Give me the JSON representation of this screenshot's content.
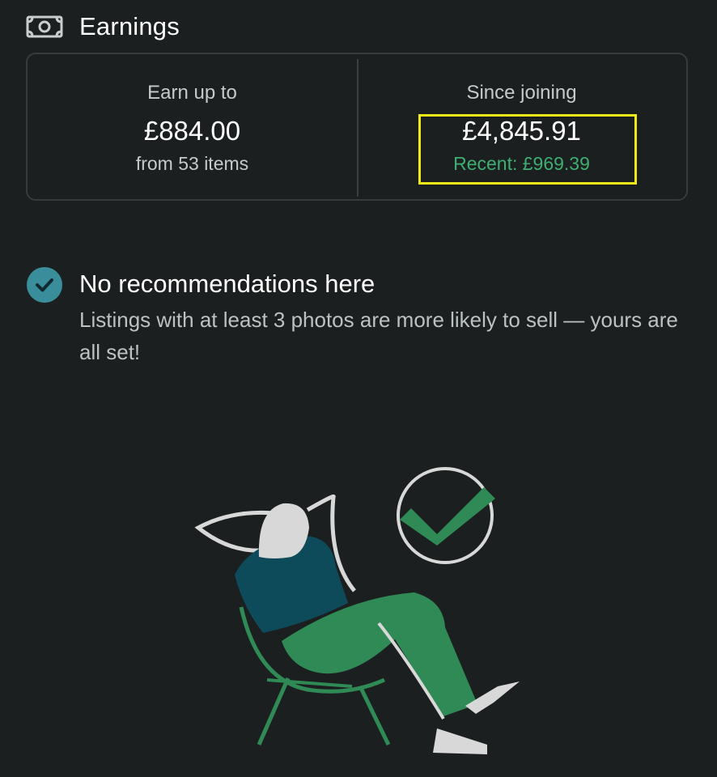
{
  "header": {
    "icon": "money-icon",
    "title": "Earnings"
  },
  "earnings": {
    "left": {
      "label": "Earn up to",
      "amount": "£884.00",
      "sub": "from 53 items"
    },
    "right": {
      "label": "Since joining",
      "amount": "£4,845.91",
      "recent": "Recent: £969.39"
    }
  },
  "recommendations": {
    "icon": "check-circle-icon",
    "title": "No recommendations here",
    "text": "Listings with at least 3 photos are more likely to sell — yours are all set!"
  },
  "illustration": {
    "icon": "relaxing-person-illustration"
  },
  "colors": {
    "background": "#1b1f1f",
    "accent_green": "#3fae72",
    "check_teal": "#3a8e9c",
    "highlight": "#f1ea16",
    "shirt": "#0d4a5a",
    "pants": "#2f8a55"
  }
}
